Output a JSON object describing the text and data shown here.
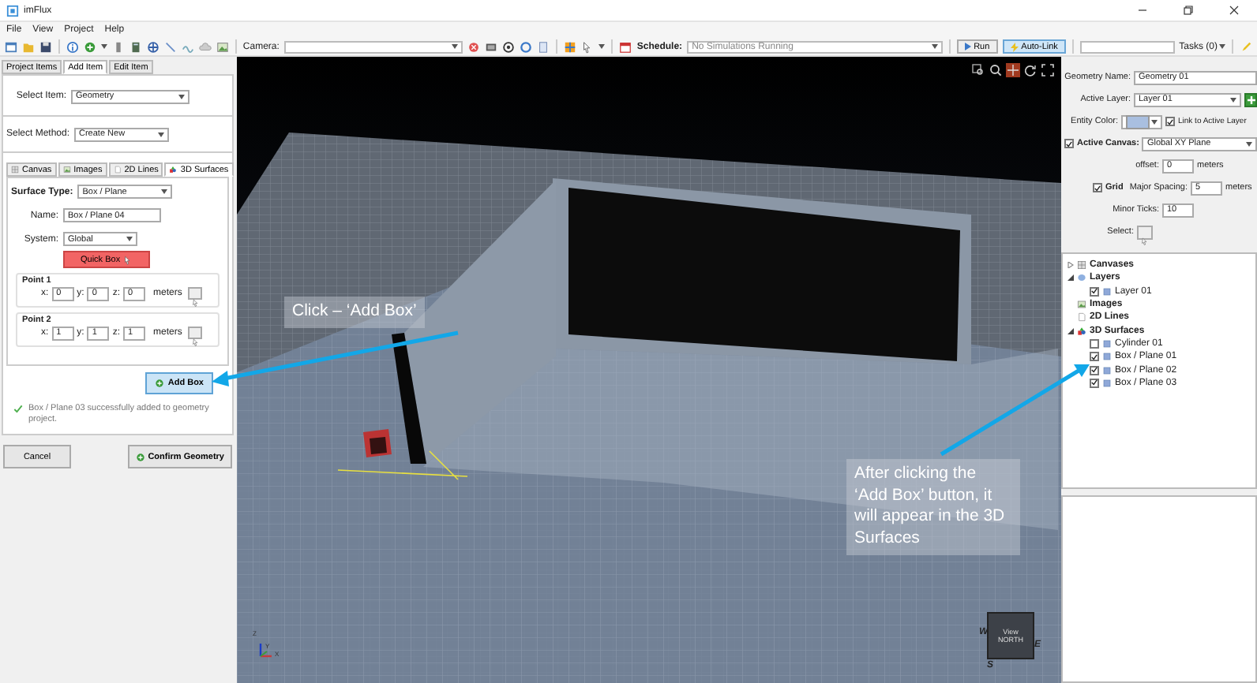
{
  "window": {
    "title": "imFlux"
  },
  "menu": [
    {
      "label": "File"
    },
    {
      "label": "View"
    },
    {
      "label": "Project"
    },
    {
      "label": "Help"
    }
  ],
  "toolbar": {
    "camera_label": "Camera:",
    "schedule_label": "Schedule:",
    "schedule_value": "No Simulations Running",
    "run": "Run",
    "auto_link": {
      "label": "Auto-Link",
      "on": true
    },
    "tasks": "Tasks (0)"
  },
  "left_panel": {
    "tabs": [
      {
        "label": "Project Items",
        "selected": false
      },
      {
        "label": "Add Item",
        "selected": true
      },
      {
        "label": "Edit Item",
        "selected": false
      }
    ],
    "select_item": {
      "label": "Select Item:",
      "value": "Geometry"
    },
    "select_method": {
      "label": "Select Method:",
      "value": "Create New"
    },
    "sub_tabs": [
      {
        "label": "Canvas",
        "selected": false
      },
      {
        "label": "Images",
        "selected": false
      },
      {
        "label": "2D Lines",
        "selected": false
      },
      {
        "label": "3D Surfaces",
        "selected": true
      }
    ],
    "surface_type": {
      "label": "Surface Type:",
      "value": "Box / Plane"
    },
    "name": {
      "label": "Name:",
      "value": "Box / Plane 04"
    },
    "system": {
      "label": "System:",
      "value": "Global"
    },
    "quick_box": "Quick Box",
    "points": [
      {
        "title": "Point 1",
        "coords": [
          {
            "label": "x:",
            "value": "0"
          },
          {
            "label": "y:",
            "value": "0"
          },
          {
            "label": "z:",
            "value": "0"
          }
        ],
        "unit": "meters"
      },
      {
        "title": "Point 2",
        "coords": [
          {
            "label": "x:",
            "value": "1"
          },
          {
            "label": "y:",
            "value": "1"
          },
          {
            "label": "z:",
            "value": "1"
          }
        ],
        "unit": "meters"
      }
    ],
    "add_box": "Add Box",
    "message": "Box / Plane 03 successfully added to geometry project.",
    "cancel": "Cancel",
    "confirm": "Confirm Geometry"
  },
  "viewport": {
    "callouts": [
      {
        "text": "Click – ‘Add Box’"
      },
      {
        "text": "After clicking the ‘Add Box’ button, it will appear in the 3D Surfaces"
      }
    ],
    "axis_labels": [
      "Z",
      "Y",
      "X"
    ],
    "view_cube": {
      "top": "View",
      "bottom": "NORTH"
    },
    "compass": {
      "west": "W",
      "east": "E",
      "south": "S"
    }
  },
  "right_panel": {
    "geometry_name": {
      "label": "Geometry Name:",
      "value": "Geometry 01"
    },
    "active_layer": {
      "label": "Active Layer:",
      "value": "Layer 01"
    },
    "entity_color": {
      "label": "Entity Color:"
    },
    "link_to_active_layer": {
      "label": "Link to Active Layer",
      "checked": true
    },
    "active_canvas": {
      "label": "Active Canvas:",
      "checked": true,
      "value": "Global XY Plane"
    },
    "offset": {
      "label": "offset:",
      "value": "0",
      "unit": "meters"
    },
    "grid": {
      "label": "Grid",
      "checked": true
    },
    "major_spacing": {
      "label": "Major Spacing:",
      "value": "5",
      "unit": "meters"
    },
    "minor_ticks": {
      "label": "Minor Ticks:",
      "value": "10"
    },
    "select": {
      "label": "Select:"
    },
    "tree": [
      {
        "label": "Canvases",
        "kind": "canvases",
        "expanded": false
      },
      {
        "label": "Layers",
        "kind": "layers",
        "expanded": true,
        "children": [
          {
            "label": "Layer 01",
            "checked": true
          }
        ]
      },
      {
        "label": "Images",
        "kind": "images"
      },
      {
        "label": "2D Lines",
        "kind": "lines"
      },
      {
        "label": "3D Surfaces",
        "kind": "surfaces",
        "expanded": true,
        "children": [
          {
            "label": "Cylinder 01",
            "checked": false
          },
          {
            "label": "Box / Plane 01",
            "checked": true
          },
          {
            "label": "Box / Plane 02",
            "checked": true
          },
          {
            "label": "Box / Plane 03",
            "checked": true
          }
        ]
      }
    ]
  }
}
